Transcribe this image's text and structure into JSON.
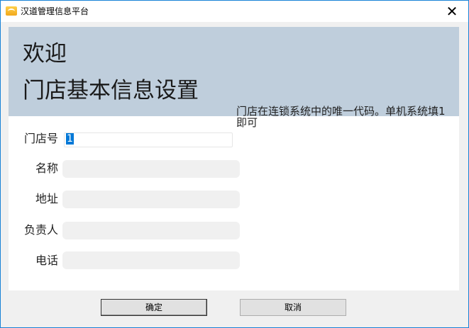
{
  "window": {
    "title": "汉道管理信息平台",
    "close_glyph": "✕"
  },
  "header": {
    "welcome": "欢迎",
    "subtitle": "门店基本信息设置"
  },
  "form": {
    "store_no": {
      "label": "门店号",
      "value": "1"
    },
    "name": {
      "label": "名称",
      "value": ""
    },
    "address": {
      "label": "地址",
      "value": ""
    },
    "manager": {
      "label": "负责人",
      "value": ""
    },
    "phone": {
      "label": "电话",
      "value": ""
    },
    "hint": "门店在连锁系统中的唯一代码。单机系统填1即可"
  },
  "buttons": {
    "ok": "确定",
    "cancel": "取消"
  },
  "colors": {
    "header_bg": "#bfcedc",
    "selection": "#0078d7",
    "window_border": "#1883d7"
  }
}
